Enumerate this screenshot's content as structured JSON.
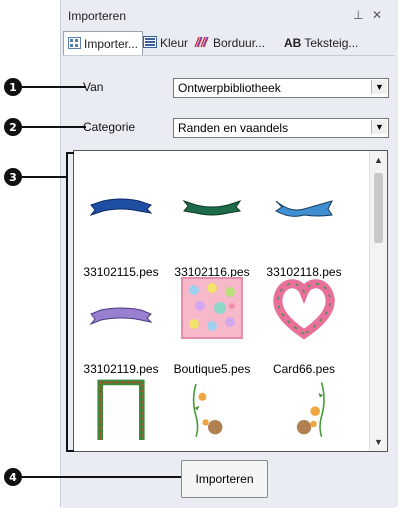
{
  "panel": {
    "title": "Importeren",
    "pin_icon": "pin-icon",
    "close_icon": "close-icon"
  },
  "tabs": [
    {
      "label": "Importer...",
      "icon": "import-grid-icon",
      "active": true
    },
    {
      "label": "Kleur",
      "icon": "color-list-icon",
      "active": false
    },
    {
      "label": "Borduur...",
      "icon": "embroidery-icon",
      "active": false
    },
    {
      "label": "Teksteig...",
      "icon": "text-properties-icon",
      "icon_text": "AB",
      "active": false
    }
  ],
  "van": {
    "label": "Van",
    "value": "Ontwerpbibliotheek"
  },
  "categorie": {
    "label": "Categorie",
    "value": "Randen en vaandels"
  },
  "gallery": {
    "items": [
      {
        "name": "33102115.pes"
      },
      {
        "name": "33102116.pes"
      },
      {
        "name": "33102118.pes"
      },
      {
        "name": "33102119.pes"
      },
      {
        "name": "Boutique5.pes"
      },
      {
        "name": "Card66.pes"
      }
    ]
  },
  "import_button": {
    "label": "Importeren"
  },
  "callouts": [
    "1",
    "2",
    "3",
    "4"
  ],
  "colors": {
    "panel_bg": "#e9edf3",
    "banner_blue": "#1f4fa3",
    "banner_green": "#1e6b4a",
    "banner_lightblue": "#3f8fd0",
    "banner_purple": "#9a7fd0"
  }
}
